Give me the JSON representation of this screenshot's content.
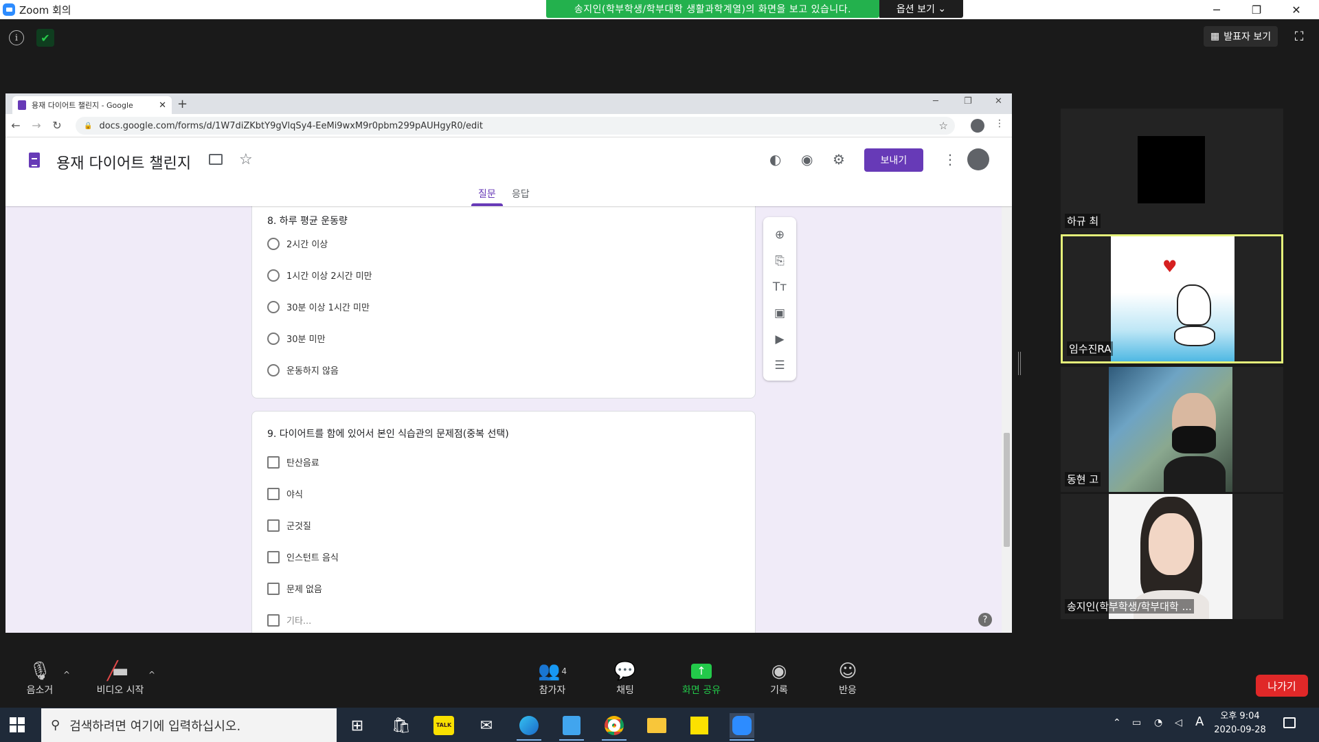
{
  "zoom": {
    "title": "Zoom 회의",
    "share_banner": "송지인(학부학생/학부대학 생활과학계열)의 화면을 보고 있습니다.",
    "view_options": "옵션 보기",
    "speaker_view": "발표자 보기",
    "info_glyph": "i",
    "shield_glyph": "✔"
  },
  "browser": {
    "tab_title": "용재 다이어트 챌린지 - Google",
    "url": "docs.google.com/forms/d/1W7diZKbtY9gVlqSy4-EeMi9wxM9r0pbm299pAUHgyR0/edit"
  },
  "form": {
    "title": "용재 다이어트 챌린지",
    "send_label": "보내기",
    "tabs": [
      "질문",
      "응답"
    ],
    "q8": {
      "title": "8. 하루 평균 운동량",
      "options": [
        "2시간 이상",
        "1시간 이상 2시간 미만",
        "30분 이상 1시간 미만",
        "30분 미만",
        "운동하지 않음"
      ]
    },
    "q9": {
      "title": "9. 다이어트를 함에 있어서 본인 식습관의 문제점(중복 선택)",
      "options": [
        "탄산음료",
        "야식",
        "군것질",
        "인스턴트 음식",
        "문제 없음",
        "기타..."
      ]
    }
  },
  "participants": [
    {
      "name": "하규 최",
      "active": false
    },
    {
      "name": "임수진RA",
      "active": true
    },
    {
      "name": "동현 고",
      "active": false
    },
    {
      "name": "송지인(학부학생/학부대학 ...",
      "active": false
    }
  ],
  "toolbar": {
    "mute": "음소거",
    "video": "비디오 시작",
    "participants": "참가자",
    "participant_count": "4",
    "chat": "채팅",
    "share": "화면 공유",
    "record": "기록",
    "reactions": "반응",
    "leave": "나가기"
  },
  "taskbar": {
    "search_placeholder": "검색하려면 여기에 입력하십시오.",
    "time": "오후 9:04",
    "date": "2020-09-28",
    "ime": "A"
  },
  "colors": {
    "banner_green": "#23b14d",
    "forms_purple": "#673ab7",
    "active_speaker": "#e5f27a",
    "leave_red": "#e02828"
  }
}
